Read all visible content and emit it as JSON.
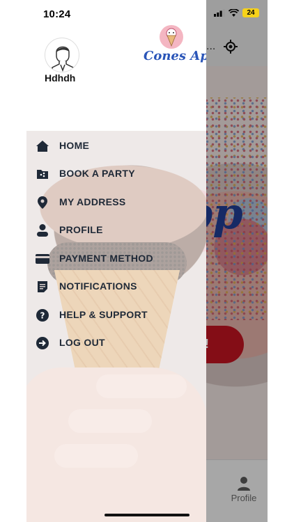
{
  "status_bar": {
    "time": "10:24",
    "battery": "24"
  },
  "user": {
    "name": "Hdhdh"
  },
  "brand": {
    "name": "Cones App"
  },
  "menu": {
    "items": [
      {
        "label": "HOME",
        "icon": "home-icon"
      },
      {
        "label": "BOOK A PARTY",
        "icon": "party-icon"
      },
      {
        "label": "MY ADDRESS",
        "icon": "location-pin-icon"
      },
      {
        "label": "PROFILE",
        "icon": "person-icon"
      },
      {
        "label": "PAYMENT METHOD",
        "icon": "credit-card-icon"
      },
      {
        "label": "NOTIFICATIONS",
        "icon": "notifications-icon"
      },
      {
        "label": "HELP & SUPPORT",
        "icon": "help-icon"
      },
      {
        "label": "LOG OUT",
        "icon": "logout-icon"
      }
    ]
  },
  "background_app": {
    "logo_fragment": "pp",
    "button_fragment": "!",
    "dots": "...",
    "profile_tab": "Profile"
  },
  "colors": {
    "menu_text": "#1f2937",
    "brand_blue": "#2a55b8",
    "accent_red": "#b8121f"
  }
}
